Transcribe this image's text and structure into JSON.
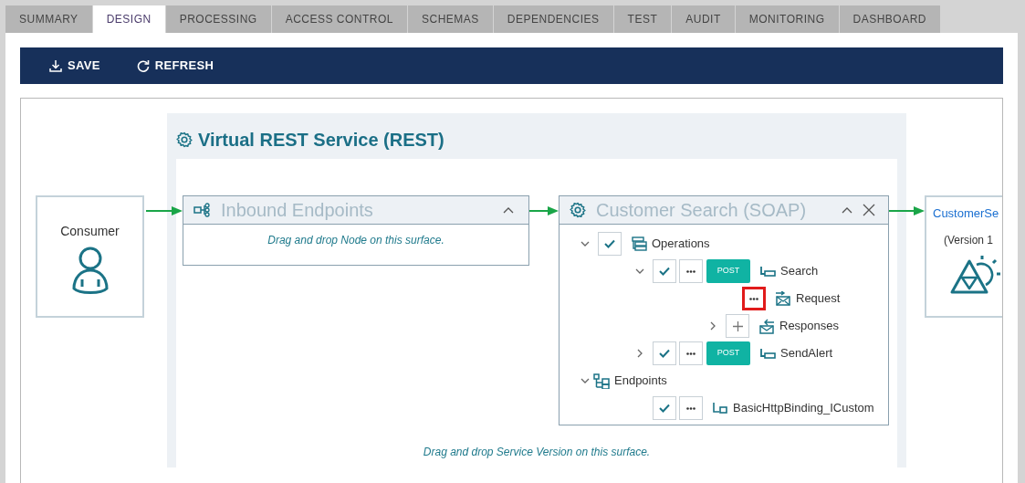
{
  "tabs": [
    {
      "label": "SUMMARY",
      "selected": false
    },
    {
      "label": "DESIGN",
      "selected": true
    },
    {
      "label": "PROCESSING",
      "selected": false
    },
    {
      "label": "ACCESS CONTROL",
      "selected": false
    },
    {
      "label": "SCHEMAS",
      "selected": false
    },
    {
      "label": "DEPENDENCIES",
      "selected": false
    },
    {
      "label": "TEST",
      "selected": false
    },
    {
      "label": "AUDIT",
      "selected": false
    },
    {
      "label": "MONITORING",
      "selected": false
    },
    {
      "label": "DASHBOARD",
      "selected": false
    }
  ],
  "toolbar": [
    {
      "label": "SAVE",
      "kind": "save"
    },
    {
      "label": "REFRESH",
      "kind": "refresh"
    }
  ],
  "diagram": {
    "service": {
      "title": "Virtual REST Service (REST)",
      "hint": "Drag and drop Service Version on this surface."
    },
    "consumer": {
      "label": "Consumer"
    },
    "inbound_node": {
      "title": "Inbound Endpoints",
      "hint": "Drag and drop Node on this surface."
    },
    "operation_node": {
      "title": "Customer Search (SOAP)",
      "tree": [
        {
          "kind": "operations",
          "label": "Operations",
          "checked": true,
          "expanded": true,
          "children": [
            {
              "kind": "operation",
              "label": "Search",
              "method": "POST",
              "checked": true,
              "expanded": true,
              "children": [
                {
                  "kind": "request",
                  "label": "Request",
                  "focused": true
                },
                {
                  "kind": "responses",
                  "label": "Responses",
                  "expanded": false
                }
              ]
            },
            {
              "kind": "operation",
              "label": "SendAlert",
              "method": "POST",
              "checked": true,
              "expanded": false
            }
          ]
        },
        {
          "kind": "endpoints",
          "label": "Endpoints",
          "expanded": true,
          "children": [
            {
              "kind": "endpoint",
              "label": "BasicHttpBinding_ICustom",
              "checked": true
            }
          ]
        }
      ]
    },
    "target_node": {
      "title": "CustomerSe",
      "subtitle": "(Version 1"
    }
  }
}
